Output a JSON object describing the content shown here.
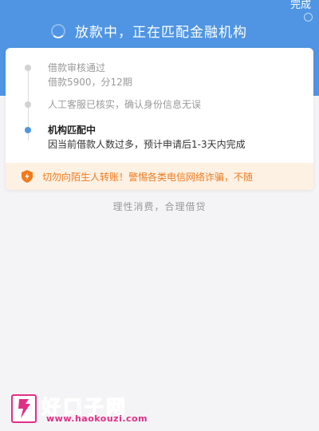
{
  "header": {
    "done_label": "完成",
    "status_text": "放款中，正在匹配金融机构"
  },
  "steps": [
    {
      "title": "借款审核通过",
      "subtitle": "借款5900，分12期",
      "state": "done"
    },
    {
      "title": "人工客服已核实，确认身份信息无误",
      "subtitle": "",
      "state": "done"
    },
    {
      "title": "机构匹配中",
      "subtitle": "因当前借款人数过多，预计申请后1-3天内完成",
      "state": "active"
    }
  ],
  "warning": {
    "text": "切勿向陌生人转账！警惕各类电信网络诈骗，不随",
    "icon": "shield-icon"
  },
  "slogan": "理性消费，合理借贷",
  "watermark": {
    "name": "好口子网",
    "url": "www.haokouzi.com"
  },
  "colors": {
    "header_blue": "#4f95e3",
    "warning_orange": "#ef7b1e",
    "warning_bg": "#fdf1e4",
    "watermark_pink": "#e22f86"
  }
}
